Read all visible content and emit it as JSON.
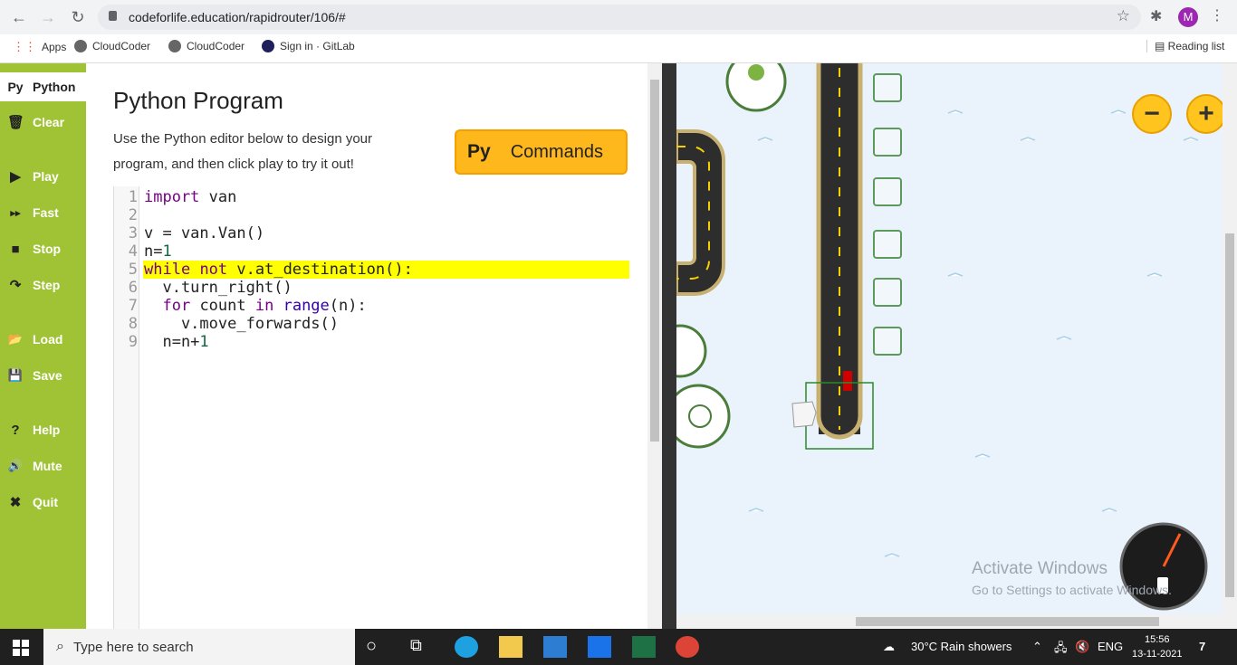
{
  "browser": {
    "url": "codeforlife.education/rapidrouter/106/#",
    "profile_initial": "M",
    "bookmarks": [
      "Apps",
      "CloudCoder",
      "CloudCoder",
      "Sign in · GitLab"
    ],
    "reading_list": "Reading list"
  },
  "sidebar": {
    "items": [
      {
        "glyph": "Py",
        "label": "Python"
      },
      {
        "glyph": "🗑",
        "label": "Clear"
      },
      {
        "glyph": "▶",
        "label": "Play"
      },
      {
        "glyph": "▸▸",
        "label": "Fast"
      },
      {
        "glyph": "■",
        "label": "Stop"
      },
      {
        "glyph": "↷",
        "label": "Step"
      },
      {
        "glyph": "📂",
        "label": "Load"
      },
      {
        "glyph": "💾",
        "label": "Save"
      },
      {
        "glyph": "?",
        "label": "Help"
      },
      {
        "glyph": "🔊",
        "label": "Mute"
      },
      {
        "glyph": "✖",
        "label": "Quit"
      }
    ]
  },
  "editor": {
    "title": "Python Program",
    "description": "Use the Python editor below to design your program, and then click play to try it out!",
    "commands_glyph": "Py",
    "commands_label": "Commands",
    "lines": [
      "1",
      "2",
      "3",
      "4",
      "5",
      "6",
      "7",
      "8",
      "9"
    ]
  },
  "map": {
    "zoom_out": "−",
    "zoom_in": "+",
    "watermark_title": "Activate Windows",
    "watermark_sub": "Go to Settings to activate Windows."
  },
  "taskbar": {
    "search_placeholder": "Type here to search",
    "weather": "30°C  Rain showers",
    "language": "ENG",
    "time": "15:56",
    "date": "13-11-2021",
    "notifications": "7"
  },
  "colors": {
    "sidebar": "#a0c335",
    "commands_button": "#ffb81c",
    "highlight": "#ffff00"
  }
}
